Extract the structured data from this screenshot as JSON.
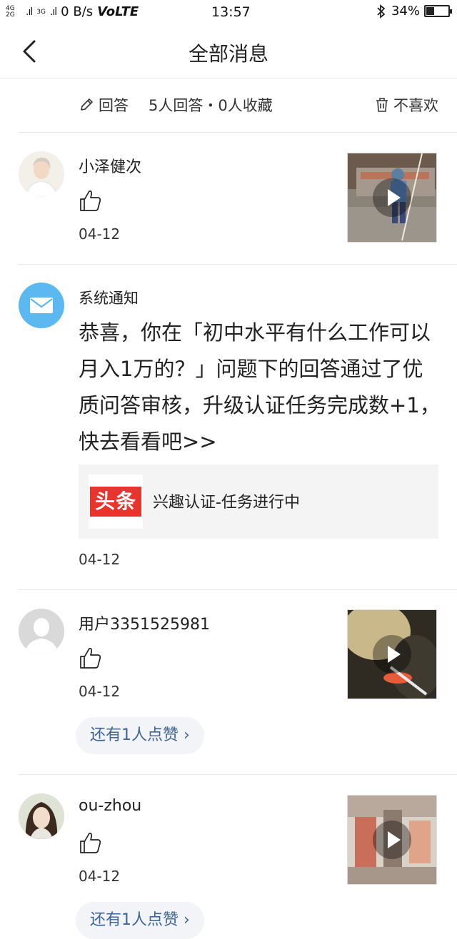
{
  "status_bar": {
    "network_top": "4G",
    "network_bottom": "2G",
    "network_3g": "3G",
    "speed": "0 B/s",
    "volte": "VoLTE",
    "time": "13:57",
    "battery": "34%",
    "battery_level": 0.34
  },
  "nav": {
    "title": "全部消息"
  },
  "summary": {
    "answer_label": "回答",
    "stats": "5人回答・0人收藏",
    "dislike_label": "不喜欢"
  },
  "messages": [
    {
      "name": "小泽健次",
      "date": "04-12",
      "has_video": true
    },
    {
      "name": "系统通知",
      "body": "恭喜，你在「初中水平有什么工作可以月入1万的？」问题下的回答通过了优质问答审核，升级认证任务完成数+1，快去看看吧>>",
      "card_logo": "头条",
      "card_title": "兴趣认证-任务进行中",
      "date": "04-12"
    },
    {
      "name": "用户3351525981",
      "date": "04-12",
      "more": "还有1人点赞 ›",
      "has_video": true
    },
    {
      "name": "ou-zhou",
      "date": "04-12",
      "more": "还有1人点赞 ›",
      "has_video": true
    }
  ],
  "colors": {
    "accent_blue": "#406599",
    "system_icon_blue": "#5bb8f0",
    "toutiao_red": "#e8342c",
    "divider": "#e6e6e6"
  }
}
